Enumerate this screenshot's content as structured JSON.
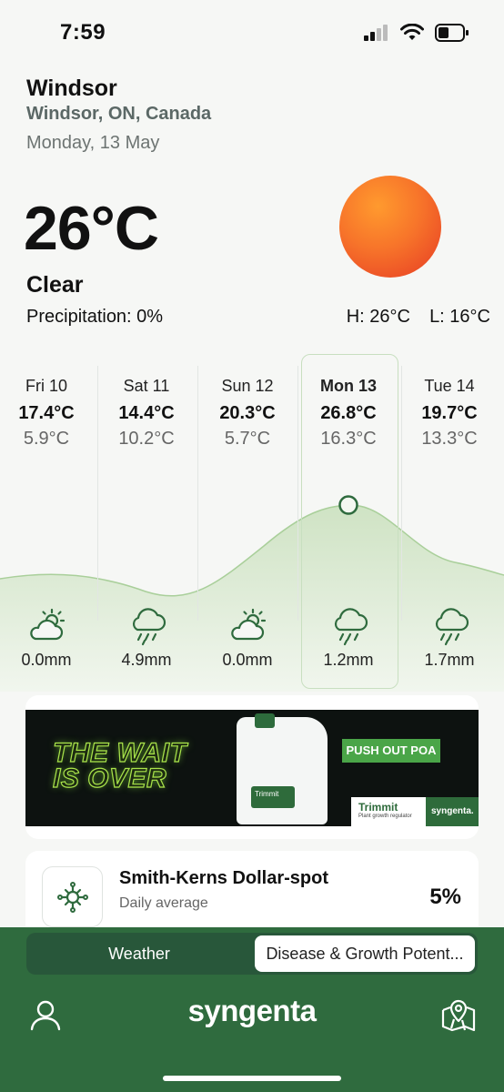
{
  "status": {
    "time": "7:59"
  },
  "location": {
    "city": "Windsor",
    "region": "Windsor, ON, Canada",
    "date": "Monday, 13 May"
  },
  "current": {
    "temp": "26°C",
    "condition": "Clear",
    "precipitation": "Precipitation: 0%",
    "high": "H: 26°C",
    "low": "L: 16°C"
  },
  "forecast": [
    {
      "day": "Fri 10",
      "hi": "17.4°C",
      "lo": "5.9°C",
      "icon": "partly-cloudy-icon",
      "rain": "0.0mm"
    },
    {
      "day": "Sat 11",
      "hi": "14.4°C",
      "lo": "10.2°C",
      "icon": "rain-cloud-icon",
      "rain": "4.9mm"
    },
    {
      "day": "Sun 12",
      "hi": "20.3°C",
      "lo": "5.7°C",
      "icon": "partly-cloudy-icon",
      "rain": "0.0mm"
    },
    {
      "day": "Mon 13",
      "hi": "26.8°C",
      "lo": "16.3°C",
      "icon": "rain-cloud-icon",
      "rain": "1.2mm",
      "selected": true
    },
    {
      "day": "Tue 14",
      "hi": "19.7°C",
      "lo": "13.3°C",
      "icon": "rain-cloud-icon",
      "rain": "1.7mm"
    }
  ],
  "ad": {
    "headline_1": "THE WAIT",
    "headline_2": "IS OVER",
    "cta": "PUSH OUT POA",
    "product": "Trimmit",
    "product_sub": "Plant growth regulator",
    "brand": "syngenta."
  },
  "disease": {
    "title": "Smith-Kerns Dollar-spot",
    "subtitle": "Daily average",
    "value": "5%"
  },
  "tabs": {
    "weather": "Weather",
    "disease": "Disease & Growth Potent..."
  },
  "footer": {
    "logo": "syngenta"
  },
  "colors": {
    "accent": "#2f6b3e",
    "sun": "#f7742a",
    "ad_green": "#4aa548"
  }
}
